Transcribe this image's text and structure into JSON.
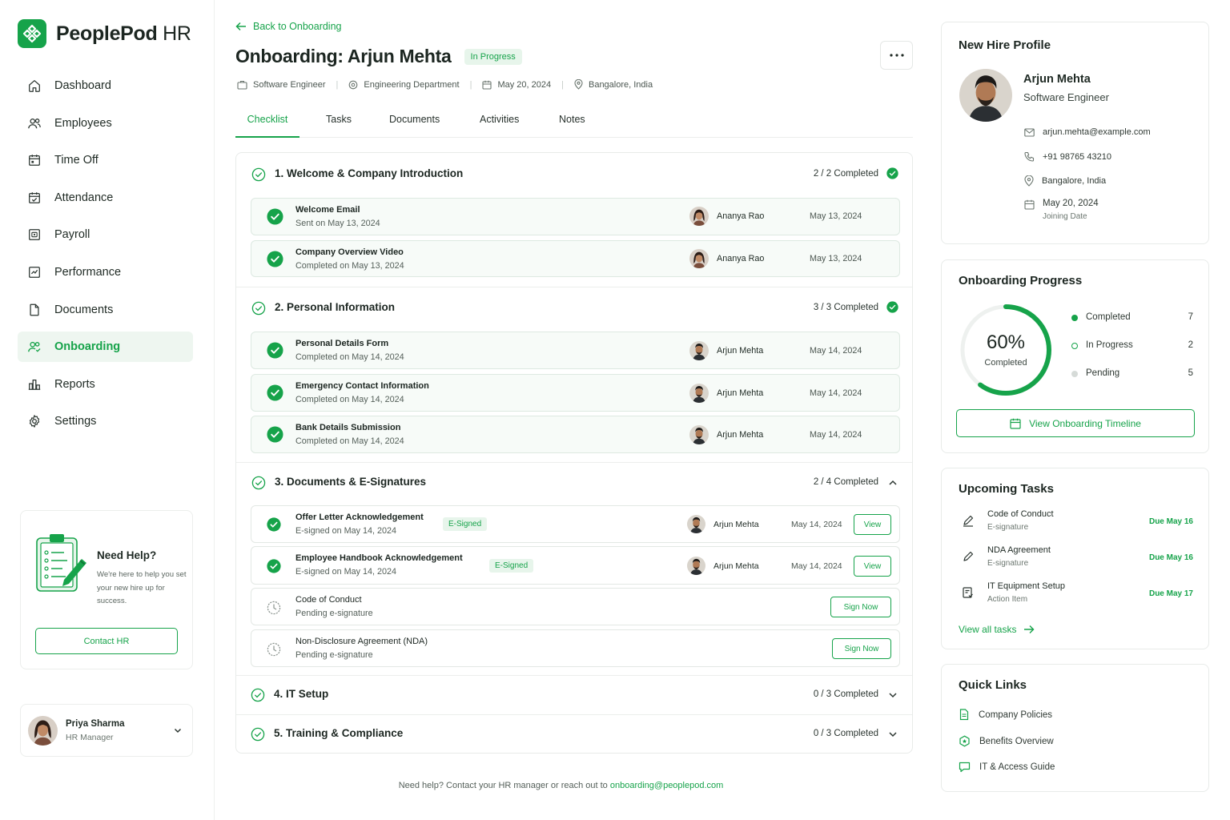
{
  "brand": {
    "name": "PeoplePod",
    "suffix": "HR"
  },
  "nav": [
    {
      "label": "Dashboard",
      "icon": "home-icon"
    },
    {
      "label": "Employees",
      "icon": "users-icon"
    },
    {
      "label": "Time Off",
      "icon": "calendar-icon"
    },
    {
      "label": "Attendance",
      "icon": "calendar-check-icon"
    },
    {
      "label": "Payroll",
      "icon": "payroll-icon"
    },
    {
      "label": "Performance",
      "icon": "chart-icon"
    },
    {
      "label": "Documents",
      "icon": "document-icon"
    },
    {
      "label": "Onboarding",
      "icon": "onboarding-icon",
      "active": true
    },
    {
      "label": "Reports",
      "icon": "reports-icon"
    },
    {
      "label": "Settings",
      "icon": "gear-icon"
    }
  ],
  "help": {
    "title": "Need Help?",
    "text": "We're here to help you set your new hire up for success.",
    "button": "Contact HR"
  },
  "current_user": {
    "name": "Priya Sharma",
    "role": "HR Manager"
  },
  "header": {
    "back_label": "Back to Onboarding",
    "title": "Onboarding: Arjun Mehta",
    "status": "In Progress",
    "meta": [
      "Software Engineer",
      "Engineering Department",
      "May 20, 2024",
      "Bangalore, India"
    ]
  },
  "tabs": [
    "Checklist",
    "Tasks",
    "Documents",
    "Activities",
    "Notes"
  ],
  "sections": [
    {
      "title": "1. Welcome & Company Introduction",
      "count": "2 / 2 Completed",
      "items": [
        {
          "title": "Welcome Email",
          "sub": "Sent on May 13, 2024",
          "person": "Ananya Rao",
          "date": "May 13, 2024"
        },
        {
          "title": "Company Overview Video",
          "sub": "Completed on May 13, 2024",
          "person": "Ananya Rao",
          "date": "May 13, 2024"
        }
      ]
    },
    {
      "title": "2. Personal Information",
      "count": "3 / 3 Completed",
      "items": [
        {
          "title": "Personal Details Form",
          "sub": "Completed on May 14, 2024",
          "person": "Arjun Mehta",
          "date": "May 14, 2024"
        },
        {
          "title": "Emergency Contact Information",
          "sub": "Completed on May 14, 2024",
          "person": "Arjun Mehta",
          "date": "May 14, 2024"
        },
        {
          "title": "Bank Details Submission",
          "sub": "Completed on May 14, 2024",
          "person": "Arjun Mehta",
          "date": "May 14, 2024"
        }
      ]
    },
    {
      "title": "3. Documents & E-Signatures",
      "count": "2 / 4 Completed",
      "items": [
        {
          "title": "Offer Letter Acknowledgement",
          "sub": "E-signed on May 14, 2024",
          "badge": "E-Signed",
          "person": "Arjun Mehta",
          "date": "May 14, 2024",
          "action": "View"
        },
        {
          "title": "Employee Handbook Acknowledgement",
          "sub": "E-signed on May 14, 2024",
          "badge": "E-Signed",
          "person": "Arjun Mehta",
          "date": "May 14, 2024",
          "action": "View"
        },
        {
          "title": "Code of Conduct",
          "sub": "Pending e-signature",
          "action": "Sign Now"
        },
        {
          "title": "Non-Disclosure Agreement (NDA)",
          "sub": "Pending e-signature",
          "action": "Sign Now"
        }
      ]
    },
    {
      "title": "4. IT Setup",
      "count": "0 / 3 Completed"
    },
    {
      "title": "5. Training & Compliance",
      "count": "0 / 3 Completed"
    }
  ],
  "footer": {
    "text": "Need help? Contact your HR manager or reach out to",
    "email": "onboarding@peoplepod.com"
  },
  "profile": {
    "title": "New Hire Profile",
    "name": "Arjun Mehta",
    "role": "Software Engineer",
    "email": "arjun.mehta@example.com",
    "phone": "+91 98765 43210",
    "location": "Bangalore, India",
    "join_date": "May 20, 2024",
    "join_label": "Joining Date"
  },
  "progress": {
    "title": "Onboarding Progress",
    "percent_label": "60%",
    "percent_value": 0.6,
    "percent_sub": "Completed",
    "legend": [
      {
        "label": "Completed",
        "value": "7"
      },
      {
        "label": "In Progress",
        "value": "2"
      },
      {
        "label": "Pending",
        "value": "5"
      }
    ],
    "button": "View Onboarding Timeline"
  },
  "upcoming": {
    "title": "Upcoming Tasks",
    "tasks": [
      {
        "title": "Code of Conduct",
        "sub": "E-signature",
        "due": "Due May 16"
      },
      {
        "title": "NDA Agreement",
        "sub": "E-signature",
        "due": "Due May 16"
      },
      {
        "title": "IT Equipment Setup",
        "sub": "Action Item",
        "due": "Due May 17"
      }
    ],
    "view_all": "View all tasks"
  },
  "quick_links": {
    "title": "Quick Links",
    "links": [
      "Company Policies",
      "Benefits Overview",
      "IT & Access Guide"
    ]
  },
  "colors": {
    "accent": "#16a34a",
    "accent_light": "#e7f5eb",
    "pending": "#c9cfcb"
  }
}
